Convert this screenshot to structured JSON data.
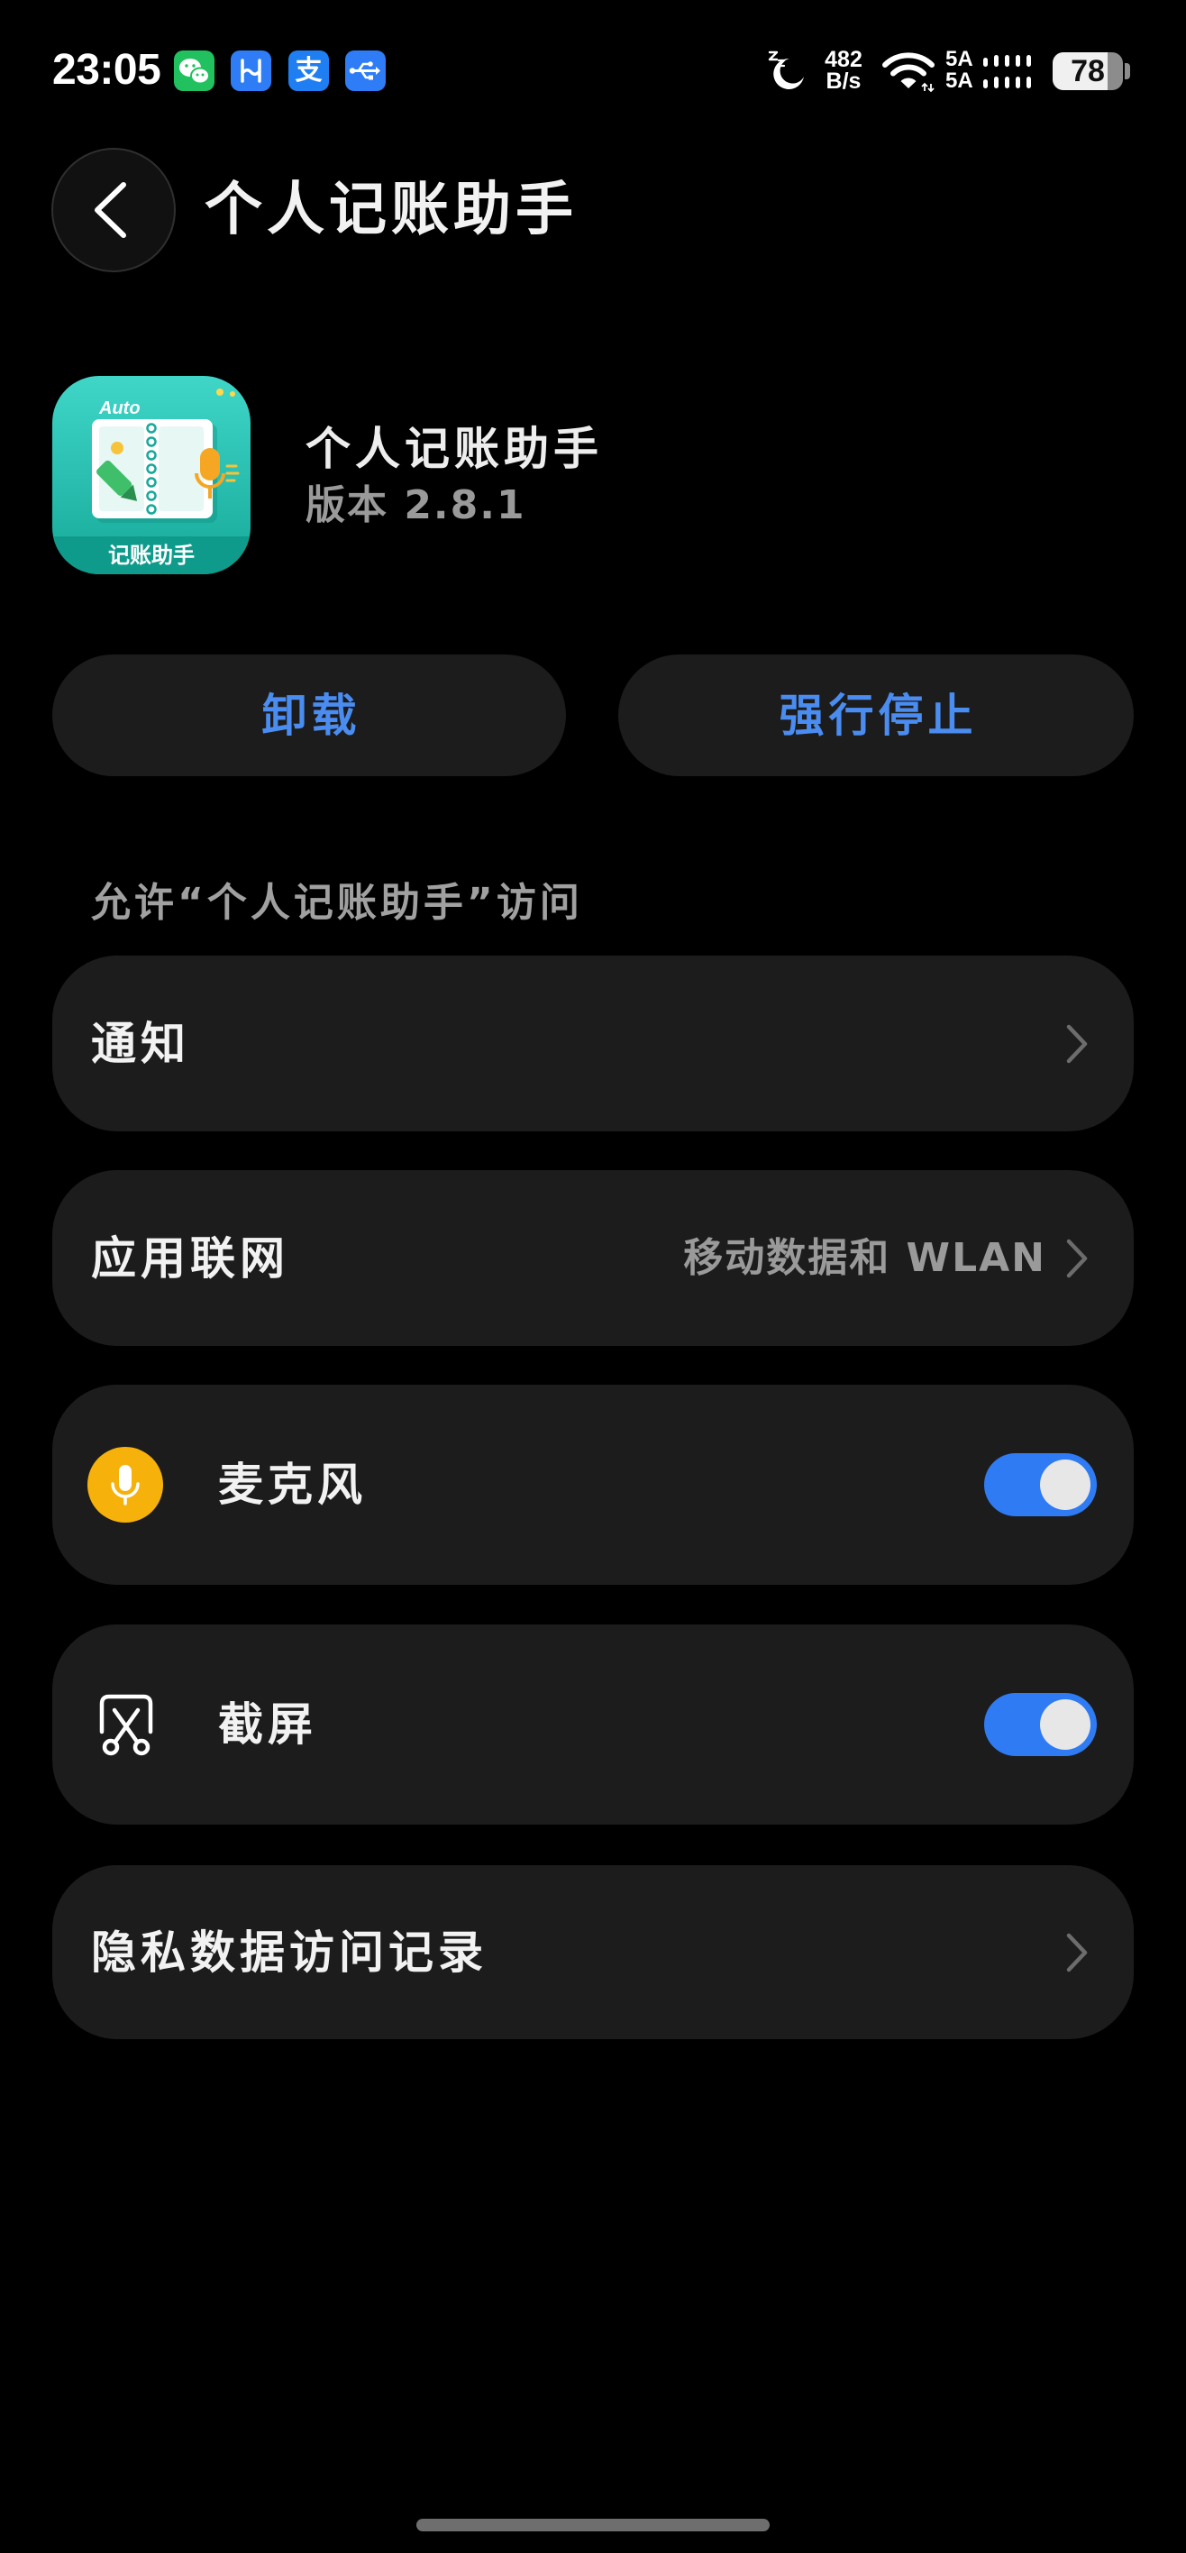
{
  "status_bar": {
    "time": "23:05",
    "notification_icons": [
      {
        "name": "wechat-icon"
      },
      {
        "name": "app-h-icon"
      },
      {
        "name": "alipay-icon",
        "glyph": "支"
      },
      {
        "name": "usb-icon"
      }
    ],
    "dnd_icon": "moon-sleep-icon",
    "net_speed": {
      "value": "482",
      "unit": "B/s"
    },
    "wifi_icon": "wifi-icon",
    "sim": [
      {
        "label": "5A"
      },
      {
        "label": "5A"
      }
    ],
    "signal_icon": "signal-bars-icon",
    "battery": {
      "level": 78,
      "text": "78"
    }
  },
  "header": {
    "back_icon": "chevron-left-icon",
    "title": "个人记账助手"
  },
  "app_info": {
    "name": "个人记账助手",
    "version": "版本 2.8.1",
    "icon": {
      "name": "app-logo-icon",
      "top_text": "Auto",
      "bottom_text": "记账助手"
    }
  },
  "actions": {
    "uninstall": "卸载",
    "force_stop": "强行停止"
  },
  "permissions": {
    "section_label": "允许“个人记账助手”访问",
    "notifications": {
      "label": "通知",
      "icon": "chevron-right-icon"
    },
    "network": {
      "label": "应用联网",
      "value": "移动数据和 WLAN",
      "icon": "chevron-right-icon"
    },
    "microphone": {
      "label": "麦克风",
      "icon": "microphone-icon",
      "enabled": true
    },
    "screenshot": {
      "label": "截屏",
      "icon": "screenshot-scissors-icon",
      "enabled": true
    },
    "privacy_log": {
      "label": "隐私数据访问记录",
      "icon": "chevron-right-icon"
    }
  },
  "colors": {
    "background": "#000000",
    "card": "#1c1c1c",
    "accent": "#4a8cf0",
    "toggle_on": "#2f7bf3",
    "microphone_icon": "#f6b10b",
    "wechat": "#21c15f",
    "app_h": "#2e7df6",
    "alipay": "#1f7ef2",
    "usb": "#2e7df6"
  }
}
